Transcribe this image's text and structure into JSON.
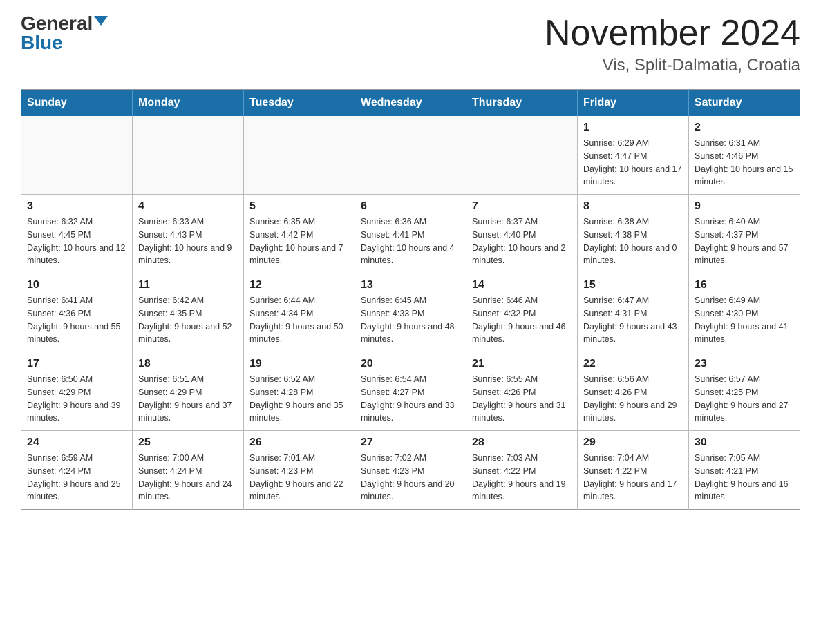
{
  "header": {
    "logo_general": "General",
    "logo_blue": "Blue",
    "month_title": "November 2024",
    "location": "Vis, Split-Dalmatia, Croatia"
  },
  "weekdays": [
    "Sunday",
    "Monday",
    "Tuesday",
    "Wednesday",
    "Thursday",
    "Friday",
    "Saturday"
  ],
  "weeks": [
    [
      {
        "day": "",
        "sunrise": "",
        "sunset": "",
        "daylight": ""
      },
      {
        "day": "",
        "sunrise": "",
        "sunset": "",
        "daylight": ""
      },
      {
        "day": "",
        "sunrise": "",
        "sunset": "",
        "daylight": ""
      },
      {
        "day": "",
        "sunrise": "",
        "sunset": "",
        "daylight": ""
      },
      {
        "day": "",
        "sunrise": "",
        "sunset": "",
        "daylight": ""
      },
      {
        "day": "1",
        "sunrise": "Sunrise: 6:29 AM",
        "sunset": "Sunset: 4:47 PM",
        "daylight": "Daylight: 10 hours and 17 minutes."
      },
      {
        "day": "2",
        "sunrise": "Sunrise: 6:31 AM",
        "sunset": "Sunset: 4:46 PM",
        "daylight": "Daylight: 10 hours and 15 minutes."
      }
    ],
    [
      {
        "day": "3",
        "sunrise": "Sunrise: 6:32 AM",
        "sunset": "Sunset: 4:45 PM",
        "daylight": "Daylight: 10 hours and 12 minutes."
      },
      {
        "day": "4",
        "sunrise": "Sunrise: 6:33 AM",
        "sunset": "Sunset: 4:43 PM",
        "daylight": "Daylight: 10 hours and 9 minutes."
      },
      {
        "day": "5",
        "sunrise": "Sunrise: 6:35 AM",
        "sunset": "Sunset: 4:42 PM",
        "daylight": "Daylight: 10 hours and 7 minutes."
      },
      {
        "day": "6",
        "sunrise": "Sunrise: 6:36 AM",
        "sunset": "Sunset: 4:41 PM",
        "daylight": "Daylight: 10 hours and 4 minutes."
      },
      {
        "day": "7",
        "sunrise": "Sunrise: 6:37 AM",
        "sunset": "Sunset: 4:40 PM",
        "daylight": "Daylight: 10 hours and 2 minutes."
      },
      {
        "day": "8",
        "sunrise": "Sunrise: 6:38 AM",
        "sunset": "Sunset: 4:38 PM",
        "daylight": "Daylight: 10 hours and 0 minutes."
      },
      {
        "day": "9",
        "sunrise": "Sunrise: 6:40 AM",
        "sunset": "Sunset: 4:37 PM",
        "daylight": "Daylight: 9 hours and 57 minutes."
      }
    ],
    [
      {
        "day": "10",
        "sunrise": "Sunrise: 6:41 AM",
        "sunset": "Sunset: 4:36 PM",
        "daylight": "Daylight: 9 hours and 55 minutes."
      },
      {
        "day": "11",
        "sunrise": "Sunrise: 6:42 AM",
        "sunset": "Sunset: 4:35 PM",
        "daylight": "Daylight: 9 hours and 52 minutes."
      },
      {
        "day": "12",
        "sunrise": "Sunrise: 6:44 AM",
        "sunset": "Sunset: 4:34 PM",
        "daylight": "Daylight: 9 hours and 50 minutes."
      },
      {
        "day": "13",
        "sunrise": "Sunrise: 6:45 AM",
        "sunset": "Sunset: 4:33 PM",
        "daylight": "Daylight: 9 hours and 48 minutes."
      },
      {
        "day": "14",
        "sunrise": "Sunrise: 6:46 AM",
        "sunset": "Sunset: 4:32 PM",
        "daylight": "Daylight: 9 hours and 46 minutes."
      },
      {
        "day": "15",
        "sunrise": "Sunrise: 6:47 AM",
        "sunset": "Sunset: 4:31 PM",
        "daylight": "Daylight: 9 hours and 43 minutes."
      },
      {
        "day": "16",
        "sunrise": "Sunrise: 6:49 AM",
        "sunset": "Sunset: 4:30 PM",
        "daylight": "Daylight: 9 hours and 41 minutes."
      }
    ],
    [
      {
        "day": "17",
        "sunrise": "Sunrise: 6:50 AM",
        "sunset": "Sunset: 4:29 PM",
        "daylight": "Daylight: 9 hours and 39 minutes."
      },
      {
        "day": "18",
        "sunrise": "Sunrise: 6:51 AM",
        "sunset": "Sunset: 4:29 PM",
        "daylight": "Daylight: 9 hours and 37 minutes."
      },
      {
        "day": "19",
        "sunrise": "Sunrise: 6:52 AM",
        "sunset": "Sunset: 4:28 PM",
        "daylight": "Daylight: 9 hours and 35 minutes."
      },
      {
        "day": "20",
        "sunrise": "Sunrise: 6:54 AM",
        "sunset": "Sunset: 4:27 PM",
        "daylight": "Daylight: 9 hours and 33 minutes."
      },
      {
        "day": "21",
        "sunrise": "Sunrise: 6:55 AM",
        "sunset": "Sunset: 4:26 PM",
        "daylight": "Daylight: 9 hours and 31 minutes."
      },
      {
        "day": "22",
        "sunrise": "Sunrise: 6:56 AM",
        "sunset": "Sunset: 4:26 PM",
        "daylight": "Daylight: 9 hours and 29 minutes."
      },
      {
        "day": "23",
        "sunrise": "Sunrise: 6:57 AM",
        "sunset": "Sunset: 4:25 PM",
        "daylight": "Daylight: 9 hours and 27 minutes."
      }
    ],
    [
      {
        "day": "24",
        "sunrise": "Sunrise: 6:59 AM",
        "sunset": "Sunset: 4:24 PM",
        "daylight": "Daylight: 9 hours and 25 minutes."
      },
      {
        "day": "25",
        "sunrise": "Sunrise: 7:00 AM",
        "sunset": "Sunset: 4:24 PM",
        "daylight": "Daylight: 9 hours and 24 minutes."
      },
      {
        "day": "26",
        "sunrise": "Sunrise: 7:01 AM",
        "sunset": "Sunset: 4:23 PM",
        "daylight": "Daylight: 9 hours and 22 minutes."
      },
      {
        "day": "27",
        "sunrise": "Sunrise: 7:02 AM",
        "sunset": "Sunset: 4:23 PM",
        "daylight": "Daylight: 9 hours and 20 minutes."
      },
      {
        "day": "28",
        "sunrise": "Sunrise: 7:03 AM",
        "sunset": "Sunset: 4:22 PM",
        "daylight": "Daylight: 9 hours and 19 minutes."
      },
      {
        "day": "29",
        "sunrise": "Sunrise: 7:04 AM",
        "sunset": "Sunset: 4:22 PM",
        "daylight": "Daylight: 9 hours and 17 minutes."
      },
      {
        "day": "30",
        "sunrise": "Sunrise: 7:05 AM",
        "sunset": "Sunset: 4:21 PM",
        "daylight": "Daylight: 9 hours and 16 minutes."
      }
    ]
  ]
}
